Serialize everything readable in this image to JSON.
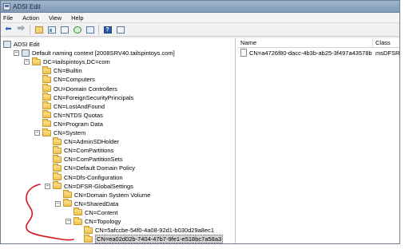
{
  "window": {
    "title": "ADSI Edit"
  },
  "menu": [
    "File",
    "Action",
    "View",
    "Help"
  ],
  "toolbar": {
    "buttons": [
      "back",
      "forward",
      "up-folder",
      "show-tree",
      "properties",
      "refresh",
      "export-list",
      "help",
      "properties-sheet"
    ]
  },
  "tree": {
    "items": [
      {
        "label": "ADSI Edit",
        "icon": "adsi-edit-icon",
        "expander": "",
        "level": 0
      },
      {
        "label": "Default naming context [2008SRV40.tailspintoys.com]",
        "icon": "server-icon",
        "expander": "-",
        "level": 1
      },
      {
        "label": "DC=tailspintoys,DC=com",
        "icon": "folder-icon",
        "expander": "-",
        "level": 2
      },
      {
        "label": "CN=Builtin",
        "icon": "folder-icon",
        "expander": "",
        "level": 3
      },
      {
        "label": "CN=Computers",
        "icon": "folder-icon",
        "expander": "",
        "level": 3
      },
      {
        "label": "OU=Domain Controllers",
        "icon": "folder-icon",
        "expander": "",
        "level": 3
      },
      {
        "label": "CN=ForeignSecurityPrincipals",
        "icon": "folder-icon",
        "expander": "",
        "level": 3
      },
      {
        "label": "CN=LostAndFound",
        "icon": "folder-icon",
        "expander": "",
        "level": 3
      },
      {
        "label": "CN=NTDS Quotas",
        "icon": "folder-icon",
        "expander": "",
        "level": 3
      },
      {
        "label": "CN=Program Data",
        "icon": "folder-icon",
        "expander": "",
        "level": 3
      },
      {
        "label": "CN=System",
        "icon": "folder-icon",
        "expander": "-",
        "level": 3
      },
      {
        "label": "CN=AdminSDHolder",
        "icon": "folder-icon",
        "expander": "",
        "level": 4
      },
      {
        "label": "CN=ComPartitions",
        "icon": "folder-icon",
        "expander": "",
        "level": 4
      },
      {
        "label": "CN=ComPartitionSets",
        "icon": "folder-icon",
        "expander": "",
        "level": 4
      },
      {
        "label": "CN=Default Domain Policy",
        "icon": "folder-icon",
        "expander": "",
        "level": 4
      },
      {
        "label": "CN=Dfs-Configuration",
        "icon": "folder-icon",
        "expander": "",
        "level": 4
      },
      {
        "label": "CN=DFSR-GlobalSettings",
        "icon": "folder-icon",
        "expander": "-",
        "level": 4
      },
      {
        "label": "CN=Domain System Volume",
        "icon": "folder-icon",
        "expander": "",
        "level": 5
      },
      {
        "label": "CN=SharedData",
        "icon": "folder-icon",
        "expander": "-",
        "level": 5
      },
      {
        "label": "CN=Content",
        "icon": "folder-icon",
        "expander": "",
        "level": 6
      },
      {
        "label": "CN=Topology",
        "icon": "folder-icon",
        "expander": "-",
        "level": 6
      },
      {
        "label": "CN=5afccbe-54f0-4a08-92d1-b030d29a8ec1",
        "icon": "folder-icon",
        "expander": "",
        "level": 7
      },
      {
        "label": "CN=ea02d02b-7404-47b7-9fe1-e518bc7a58a3",
        "icon": "folder-icon",
        "expander": "",
        "level": 7,
        "selected": true
      }
    ]
  },
  "list": {
    "columns": {
      "name": "Name",
      "class": "Class"
    },
    "rows": [
      {
        "name": "CN=a4726f80-dacc-4b3b-ab25-3f497a43578b",
        "class": "msDFSR-C"
      }
    ]
  },
  "colors": {
    "selection": "#d4d4d4",
    "annotation": "#d8141c",
    "titlebar": "#8ca6c3"
  }
}
